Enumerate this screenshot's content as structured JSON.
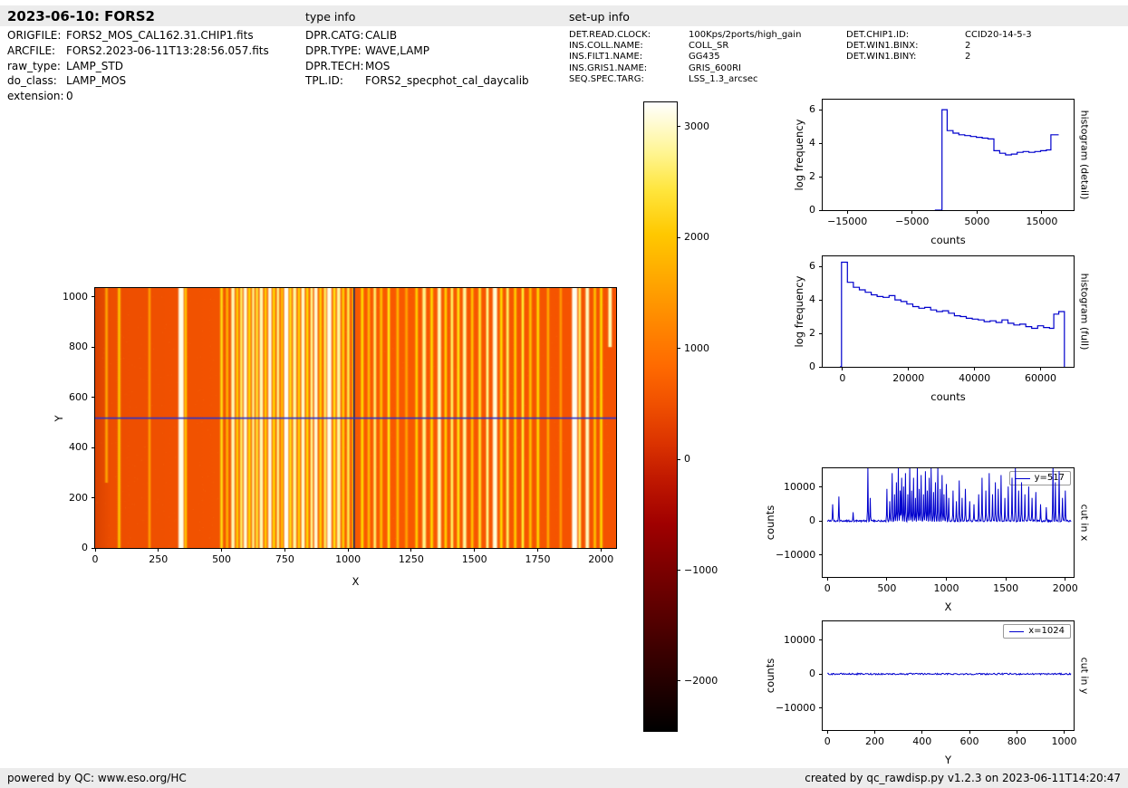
{
  "header": {
    "title": "2023-06-10: FORS2",
    "type_info": "type info",
    "setup_info": "set-up info"
  },
  "file_info": {
    "rows": [
      {
        "label": "ORIGFILE:",
        "value": "FORS2_MOS_CAL162.31.CHIP1.fits"
      },
      {
        "label": "ARCFILE:",
        "value": "FORS2.2023-06-11T13:28:56.057.fits"
      },
      {
        "label": "raw_type:",
        "value": "LAMP_STD"
      },
      {
        "label": "do_class:",
        "value": "LAMP_MOS"
      },
      {
        "label": "extension:",
        "value": "0"
      }
    ]
  },
  "type_info": {
    "rows": [
      {
        "label": "DPR.CATG:",
        "value": "CALIB"
      },
      {
        "label": "DPR.TYPE:",
        "value": "WAVE,LAMP"
      },
      {
        "label": "DPR.TECH:",
        "value": "MOS"
      },
      {
        "label": "TPL.ID:",
        "value": "FORS2_specphot_cal_daycalib"
      }
    ]
  },
  "setup_info": {
    "rows": [
      {
        "label": "DET.READ.CLOCK:",
        "value": "100Kps/2ports/high_gain"
      },
      {
        "label": "INS.COLL.NAME:",
        "value": "COLL_SR"
      },
      {
        "label": "INS.FILT1.NAME:",
        "value": "GG435"
      },
      {
        "label": "INS.GRIS1.NAME:",
        "value": "GRIS_600RI"
      },
      {
        "label": "SEQ.SPEC.TARG:",
        "value": "LSS_1.3_arcsec"
      }
    ]
  },
  "setup_info2": {
    "rows": [
      {
        "label": "DET.CHIP1.ID:",
        "value": "CCID20-14-5-3"
      },
      {
        "label": "DET.WIN1.BINX:",
        "value": "2"
      },
      {
        "label": "DET.WIN1.BINY:",
        "value": "2"
      }
    ]
  },
  "footer": {
    "left": "powered by QC: www.eso.org/HC",
    "right": "created by qc_rawdisp.py v1.2.3 on 2023-06-11T14:20:47"
  },
  "chart_data": [
    {
      "id": "raw_image",
      "type": "heatmap",
      "title": "",
      "xlabel": "X",
      "ylabel": "Y",
      "xlim": [
        0,
        2060
      ],
      "ylim": [
        0,
        1035
      ],
      "xticks": [
        0,
        250,
        500,
        750,
        1000,
        1250,
        1500,
        1750,
        2000
      ],
      "yticks": [
        0,
        200,
        400,
        600,
        800,
        1000
      ],
      "colormap": "hot",
      "background_color": "#f85600",
      "crosshair": {
        "x": 1024,
        "y": 517,
        "h_color": "#2633cf",
        "v_color": "#181a66"
      },
      "description": "raw MOS arc-lamp frame: uniform orange background with bright vertical emission lines; blue horizontal cut line at y=517 and dark vertical cut line at x=1024",
      "emission_lines_format": "[x, intensity 0-1, width_px, optional y_min]",
      "emission_lines": [
        [
          45,
          0.5,
          2,
          260
        ],
        [
          95,
          0.62,
          2
        ],
        [
          215,
          0.35,
          2
        ],
        [
          340,
          0.97,
          5
        ],
        [
          358,
          0.6,
          2
        ],
        [
          500,
          0.72,
          2
        ],
        [
          522,
          0.55,
          2
        ],
        [
          545,
          0.9,
          3
        ],
        [
          562,
          0.65,
          2
        ],
        [
          578,
          0.8,
          2
        ],
        [
          594,
          0.95,
          3
        ],
        [
          610,
          0.7,
          2
        ],
        [
          625,
          0.85,
          2
        ],
        [
          640,
          0.75,
          2
        ],
        [
          657,
          0.9,
          3
        ],
        [
          674,
          0.65,
          2
        ],
        [
          691,
          0.96,
          3
        ],
        [
          707,
          0.7,
          2
        ],
        [
          723,
          0.85,
          2
        ],
        [
          739,
          0.6,
          2
        ],
        [
          756,
          0.98,
          4
        ],
        [
          772,
          0.72,
          2
        ],
        [
          789,
          0.88,
          3
        ],
        [
          806,
          0.65,
          2
        ],
        [
          822,
          0.92,
          3
        ],
        [
          839,
          0.7,
          2
        ],
        [
          856,
          0.85,
          2
        ],
        [
          873,
          0.95,
          3
        ],
        [
          891,
          0.68,
          2
        ],
        [
          909,
          0.8,
          2
        ],
        [
          926,
          0.97,
          4
        ],
        [
          946,
          0.72,
          2
        ],
        [
          963,
          0.88,
          3
        ],
        [
          981,
          0.65,
          2
        ],
        [
          1001,
          0.78,
          2
        ],
        [
          1021,
          0.6,
          2
        ],
        [
          1056,
          0.7,
          2
        ],
        [
          1082,
          0.55,
          2
        ],
        [
          1106,
          0.82,
          2
        ],
        [
          1131,
          0.6,
          2
        ],
        [
          1161,
          0.72,
          2
        ],
        [
          1196,
          0.55,
          2
        ],
        [
          1231,
          0.5,
          2
        ],
        [
          1271,
          0.65,
          2
        ],
        [
          1301,
          0.85,
          3
        ],
        [
          1331,
          0.7,
          2
        ],
        [
          1361,
          0.9,
          3
        ],
        [
          1386,
          0.65,
          2
        ],
        [
          1411,
          0.8,
          2
        ],
        [
          1436,
          0.72,
          2
        ],
        [
          1461,
          0.88,
          3
        ],
        [
          1491,
          0.6,
          2
        ],
        [
          1521,
          0.75,
          2
        ],
        [
          1551,
          0.85,
          2
        ],
        [
          1581,
          0.95,
          4
        ],
        [
          1606,
          0.7,
          2
        ],
        [
          1631,
          0.8,
          2
        ],
        [
          1661,
          0.65,
          2
        ],
        [
          1691,
          0.75,
          2
        ],
        [
          1721,
          0.6,
          2
        ],
        [
          1751,
          0.68,
          2
        ],
        [
          1791,
          0.5,
          2
        ],
        [
          1841,
          0.45,
          2
        ],
        [
          1896,
          0.98,
          5
        ],
        [
          1916,
          0.8,
          2
        ],
        [
          1946,
          0.92,
          3
        ],
        [
          1976,
          0.6,
          2
        ],
        [
          2001,
          0.7,
          2
        ],
        [
          2036,
          0.9,
          3,
          800
        ]
      ]
    },
    {
      "id": "colorbar",
      "type": "colorbar",
      "vmin": -2450,
      "vmax": 3220,
      "ticks": [
        3000,
        2000,
        1000,
        0,
        -1000,
        -2000
      ],
      "colormap": "hot",
      "gradient_stops": [
        {
          "pos": 0.0,
          "color": "#000000"
        },
        {
          "pos": 0.06,
          "color": "#1c0000"
        },
        {
          "pos": 0.13,
          "color": "#3d0000"
        },
        {
          "pos": 0.2,
          "color": "#600000"
        },
        {
          "pos": 0.27,
          "color": "#820000"
        },
        {
          "pos": 0.33,
          "color": "#a00000"
        },
        {
          "pos": 0.4,
          "color": "#c01800"
        },
        {
          "pos": 0.46,
          "color": "#dc3400"
        },
        {
          "pos": 0.52,
          "color": "#f05000"
        },
        {
          "pos": 0.58,
          "color": "#ff6a00"
        },
        {
          "pos": 0.65,
          "color": "#ff8800"
        },
        {
          "pos": 0.72,
          "color": "#ffa800"
        },
        {
          "pos": 0.79,
          "color": "#ffc800"
        },
        {
          "pos": 0.86,
          "color": "#ffe53c"
        },
        {
          "pos": 0.92,
          "color": "#fff592"
        },
        {
          "pos": 1.0,
          "color": "#ffffff"
        }
      ]
    },
    {
      "id": "histogram_detail",
      "type": "line",
      "step": true,
      "xlabel": "counts",
      "ylabel": "log frequency",
      "right_label": "histogram (detail)",
      "color": "#0000cd",
      "xlim": [
        -18800,
        19900
      ],
      "ylim": [
        0,
        6.6
      ],
      "xticks": [
        -15000,
        -5000,
        5000,
        15000
      ],
      "yticks": [
        0,
        2,
        4,
        6
      ],
      "points": [
        [
          -1500,
          0
        ],
        [
          -400,
          6.0
        ],
        [
          400,
          4.75
        ],
        [
          1300,
          4.6
        ],
        [
          2200,
          4.5
        ],
        [
          3100,
          4.45
        ],
        [
          4000,
          4.4
        ],
        [
          4900,
          4.35
        ],
        [
          5800,
          4.3
        ],
        [
          6700,
          4.25
        ],
        [
          7600,
          3.55
        ],
        [
          8500,
          3.4
        ],
        [
          9400,
          3.3
        ],
        [
          10300,
          3.35
        ],
        [
          11200,
          3.45
        ],
        [
          12100,
          3.5
        ],
        [
          13000,
          3.45
        ],
        [
          13900,
          3.5
        ],
        [
          14800,
          3.55
        ],
        [
          15700,
          3.6
        ],
        [
          16400,
          4.5
        ],
        [
          17600,
          4.5
        ]
      ]
    },
    {
      "id": "histogram_full",
      "type": "line",
      "step": true,
      "xlabel": "counts",
      "ylabel": "log frequency",
      "right_label": "histogram (full)",
      "color": "#0000cd",
      "xlim": [
        -6000,
        70000
      ],
      "ylim": [
        0,
        6.6
      ],
      "xticks": [
        0,
        20000,
        40000,
        60000
      ],
      "yticks": [
        0,
        2,
        4,
        6
      ],
      "points": [
        [
          -800,
          0
        ],
        [
          -300,
          6.25
        ],
        [
          1500,
          5.05
        ],
        [
          3300,
          4.75
        ],
        [
          5100,
          4.6
        ],
        [
          6900,
          4.45
        ],
        [
          8700,
          4.3
        ],
        [
          10500,
          4.2
        ],
        [
          12300,
          4.15
        ],
        [
          14100,
          4.25
        ],
        [
          15900,
          4.0
        ],
        [
          17700,
          3.9
        ],
        [
          19500,
          3.75
        ],
        [
          21300,
          3.6
        ],
        [
          23100,
          3.5
        ],
        [
          24900,
          3.55
        ],
        [
          26700,
          3.4
        ],
        [
          28500,
          3.3
        ],
        [
          30300,
          3.35
        ],
        [
          32100,
          3.2
        ],
        [
          33900,
          3.05
        ],
        [
          35700,
          3.0
        ],
        [
          37500,
          2.9
        ],
        [
          39300,
          2.85
        ],
        [
          41100,
          2.8
        ],
        [
          42900,
          2.7
        ],
        [
          44700,
          2.75
        ],
        [
          46500,
          2.65
        ],
        [
          48300,
          2.8
        ],
        [
          50100,
          2.6
        ],
        [
          51900,
          2.5
        ],
        [
          53700,
          2.55
        ],
        [
          55500,
          2.4
        ],
        [
          57300,
          2.3
        ],
        [
          59100,
          2.45
        ],
        [
          60900,
          2.35
        ],
        [
          62700,
          2.3
        ],
        [
          64000,
          3.15
        ],
        [
          65500,
          3.3
        ],
        [
          67200,
          0
        ]
      ]
    },
    {
      "id": "cut_x",
      "type": "line",
      "xlabel": "X",
      "ylabel": "counts",
      "right_label": "cut in x",
      "legend": "y=517",
      "color": "#0000cd",
      "xlim": [
        -40,
        2070
      ],
      "ylim": [
        -16500,
        15500
      ],
      "xticks": [
        0,
        500,
        1000,
        1500,
        2000
      ],
      "yticks": [
        -10000,
        0,
        10000
      ],
      "noise_amplitude": 250,
      "spike_scale": 17000,
      "spikes_from": "raw_image.emission_lines",
      "description": "row cut at y=517: baseline near 0 counts with tall spikes at the arc-lamp emission line positions, brightest spikes clipped at plot top"
    },
    {
      "id": "cut_y",
      "type": "line",
      "xlabel": "Y",
      "ylabel": "counts",
      "right_label": "cut in y",
      "legend": "x=1024",
      "color": "#0000cd",
      "xlim": [
        -20,
        1040
      ],
      "ylim": [
        -16500,
        15500
      ],
      "xticks": [
        0,
        200,
        400,
        600,
        800,
        1000
      ],
      "yticks": [
        -10000,
        0,
        10000
      ],
      "noise_amplitude": 220,
      "description": "column cut at x=1024: essentially flat line near 0 counts across full Y range"
    }
  ]
}
